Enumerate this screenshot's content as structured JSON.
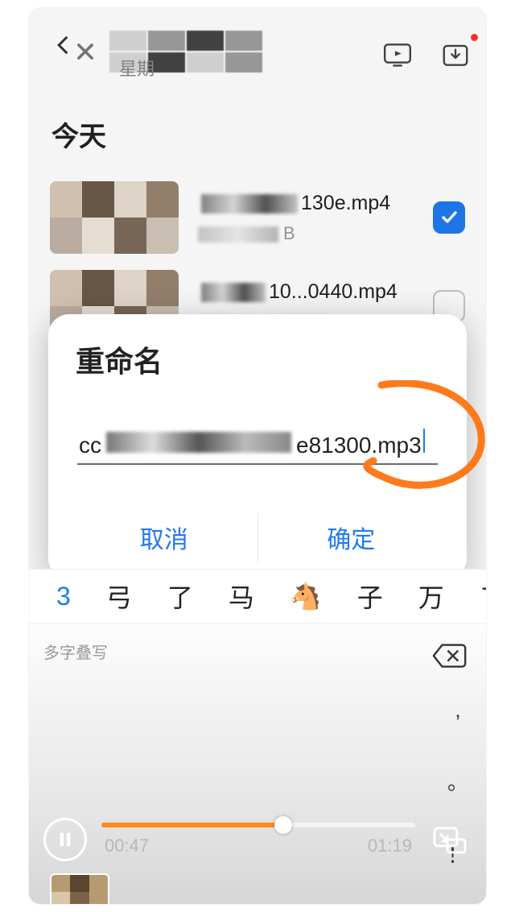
{
  "header": {
    "weekday_prefix": "星期",
    "cast_icon": "tv-cast-icon",
    "share_icon": "share-download-icon"
  },
  "list": {
    "section_title": "今天",
    "items": [
      {
        "name_suffix": "130e.mp4",
        "size_suffix": "B",
        "checked": true
      },
      {
        "name_suffix": "10...0440.mp4",
        "size_suffix": "",
        "checked": false
      }
    ]
  },
  "dialog": {
    "title": "重命名",
    "input_prefix": "cc",
    "input_suffix": "e81300.mp3",
    "cancel": "取消",
    "confirm": "确定"
  },
  "ime": {
    "candidates": [
      "3",
      "弓",
      "了",
      "马",
      "🐴",
      "子",
      "万",
      "ㄗ"
    ],
    "hint": "多字叠写"
  },
  "keyboard_side": [
    ",",
    "。",
    "！"
  ],
  "player": {
    "current": "00:47",
    "total": "01:19",
    "progress_pct": 58
  }
}
